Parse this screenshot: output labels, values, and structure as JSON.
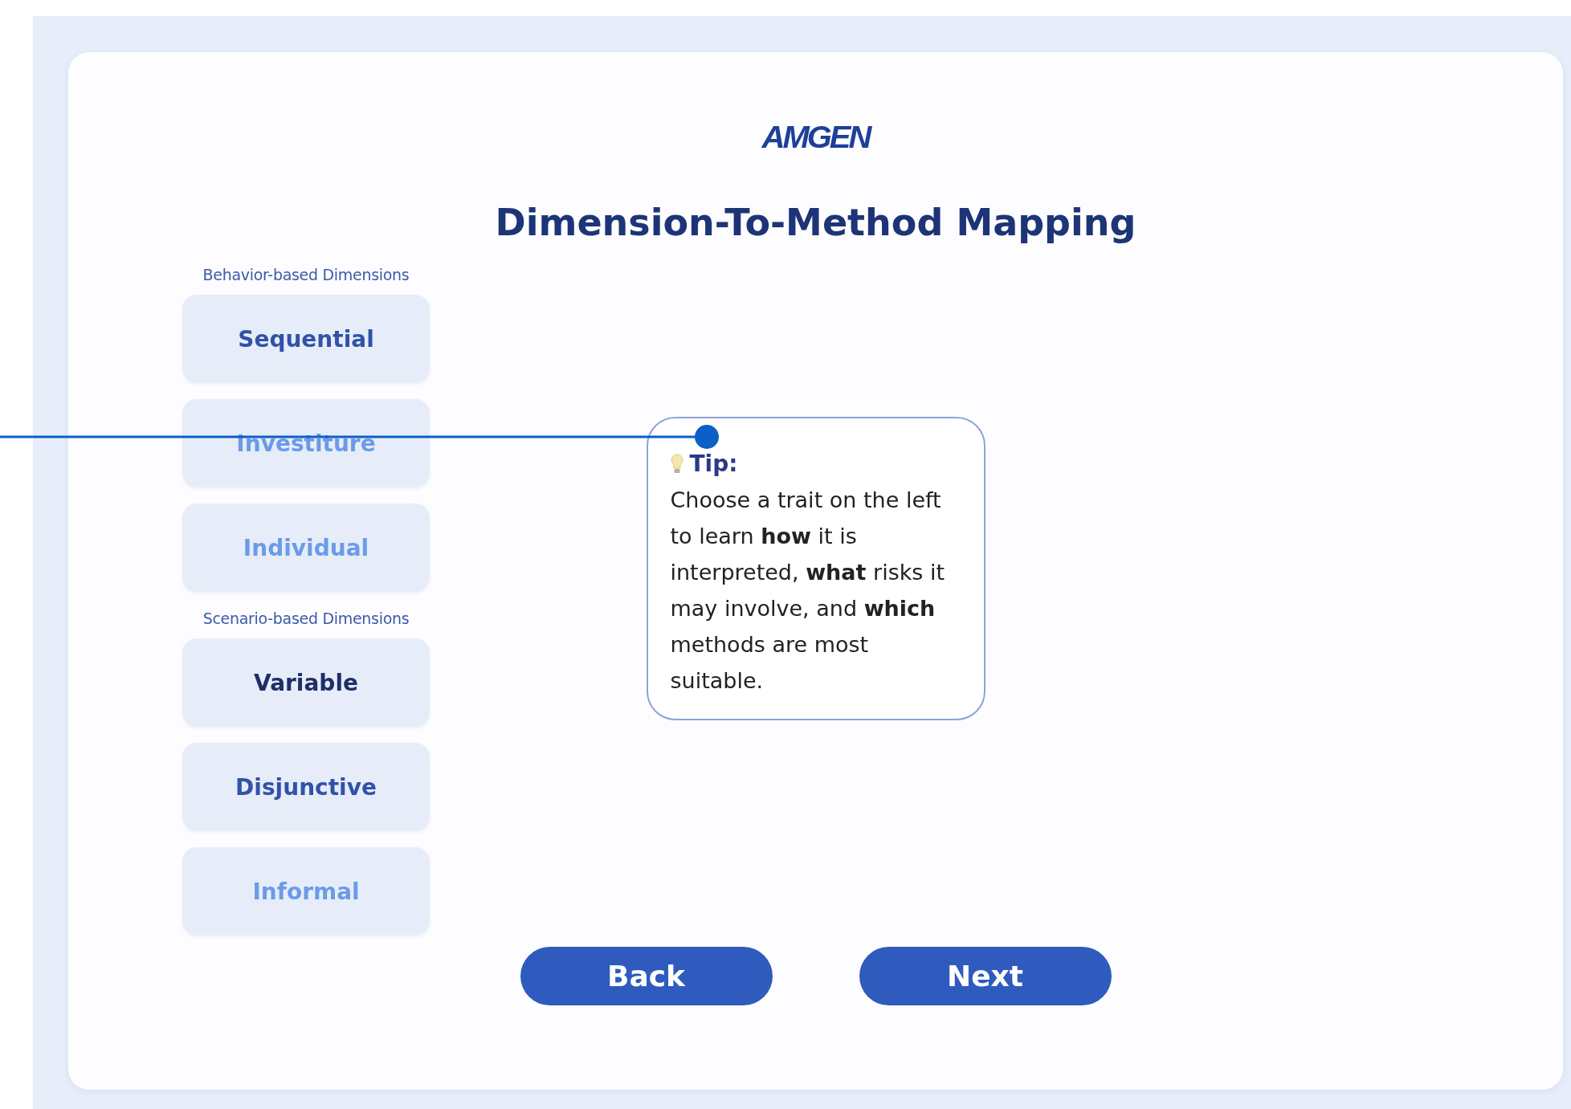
{
  "logo": "AMGEN",
  "title": "Dimension-To-Method Mapping",
  "groups": [
    {
      "label": "Behavior-based Dimensions",
      "items": [
        {
          "label": "Sequential",
          "selected": false,
          "visited": true
        },
        {
          "label": "Investiture",
          "selected": false,
          "visited": false
        },
        {
          "label": "Individual",
          "selected": false,
          "visited": false
        }
      ]
    },
    {
      "label": "Scenario-based Dimensions",
      "items": [
        {
          "label": "Variable",
          "selected": true,
          "visited": true
        },
        {
          "label": "Disjunctive",
          "selected": false,
          "visited": true
        },
        {
          "label": "Informal",
          "selected": false,
          "visited": false
        }
      ]
    }
  ],
  "tip": {
    "label": "Tip:",
    "text": "Choose a trait on the left to learn **how** it is interpreted, **what** risks it may involve, and **which** methods are most suitable."
  },
  "buttons": [
    "Back",
    "Next"
  ]
}
